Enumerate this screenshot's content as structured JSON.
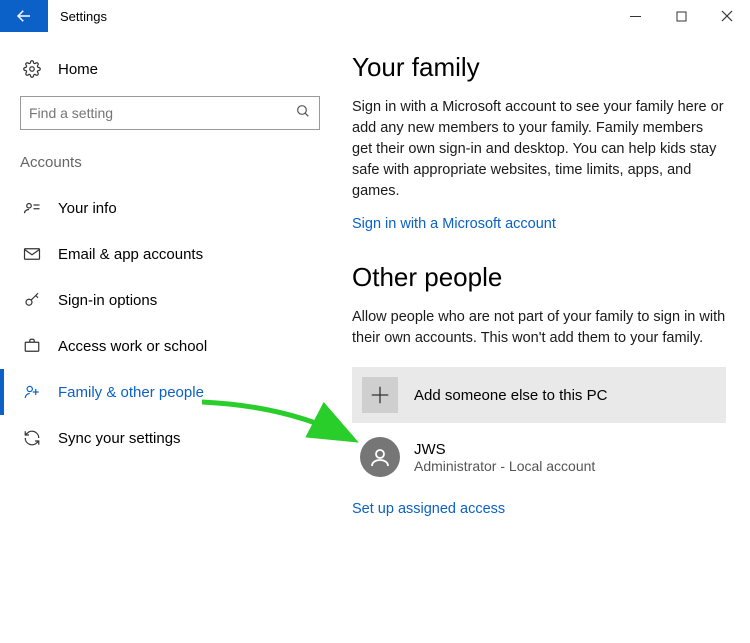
{
  "window": {
    "title": "Settings"
  },
  "sidebar": {
    "home_label": "Home",
    "search_placeholder": "Find a setting",
    "category": "Accounts",
    "items": [
      {
        "label": "Your info"
      },
      {
        "label": "Email & app accounts"
      },
      {
        "label": "Sign-in options"
      },
      {
        "label": "Access work or school"
      },
      {
        "label": "Family & other people"
      },
      {
        "label": "Sync your settings"
      }
    ]
  },
  "main": {
    "family": {
      "heading": "Your family",
      "description": "Sign in with a Microsoft account to see your family here or add any new members to your family. Family members get their own sign-in and desktop. You can help kids stay safe with appropriate websites, time limits, apps, and games.",
      "signin_link": "Sign in with a Microsoft account"
    },
    "other": {
      "heading": "Other people",
      "description": "Allow people who are not part of your family to sign in with their own accounts. This won't add them to your family.",
      "add_label": "Add someone else to this PC",
      "assigned_link": "Set up assigned access"
    },
    "user": {
      "name": "JWS",
      "role": "Administrator - Local account"
    }
  }
}
